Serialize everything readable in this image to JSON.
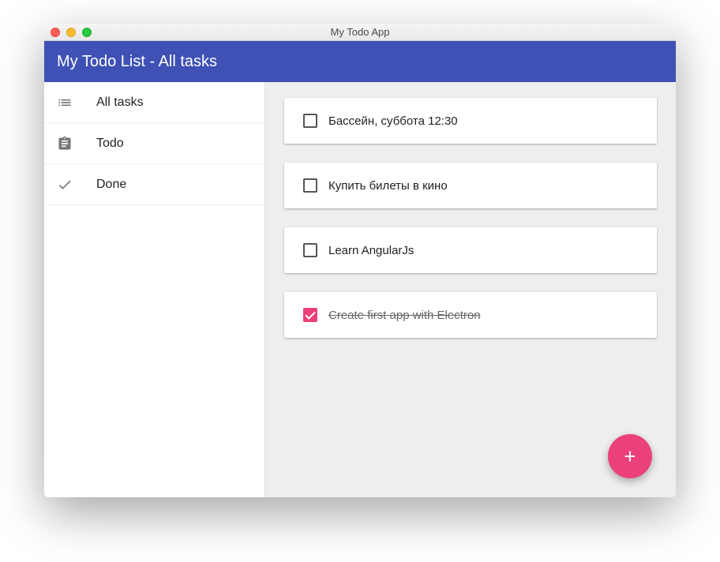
{
  "window": {
    "title": "My Todo App"
  },
  "appbar": {
    "title": "My Todo List - All tasks"
  },
  "sidebar": {
    "items": [
      {
        "label": "All tasks",
        "icon": "list-icon"
      },
      {
        "label": "Todo",
        "icon": "clipboard-icon"
      },
      {
        "label": "Done",
        "icon": "check-icon"
      }
    ]
  },
  "tasks": [
    {
      "label": "Бассейн, суббота 12:30",
      "done": false
    },
    {
      "label": "Купить билеты в кино",
      "done": false
    },
    {
      "label": "Learn AngularJs",
      "done": false
    },
    {
      "label": "Create first app with Electron",
      "done": true
    }
  ],
  "fab": {
    "label": "+"
  },
  "colors": {
    "primary": "#3f51b5",
    "accent": "#ec407a"
  }
}
